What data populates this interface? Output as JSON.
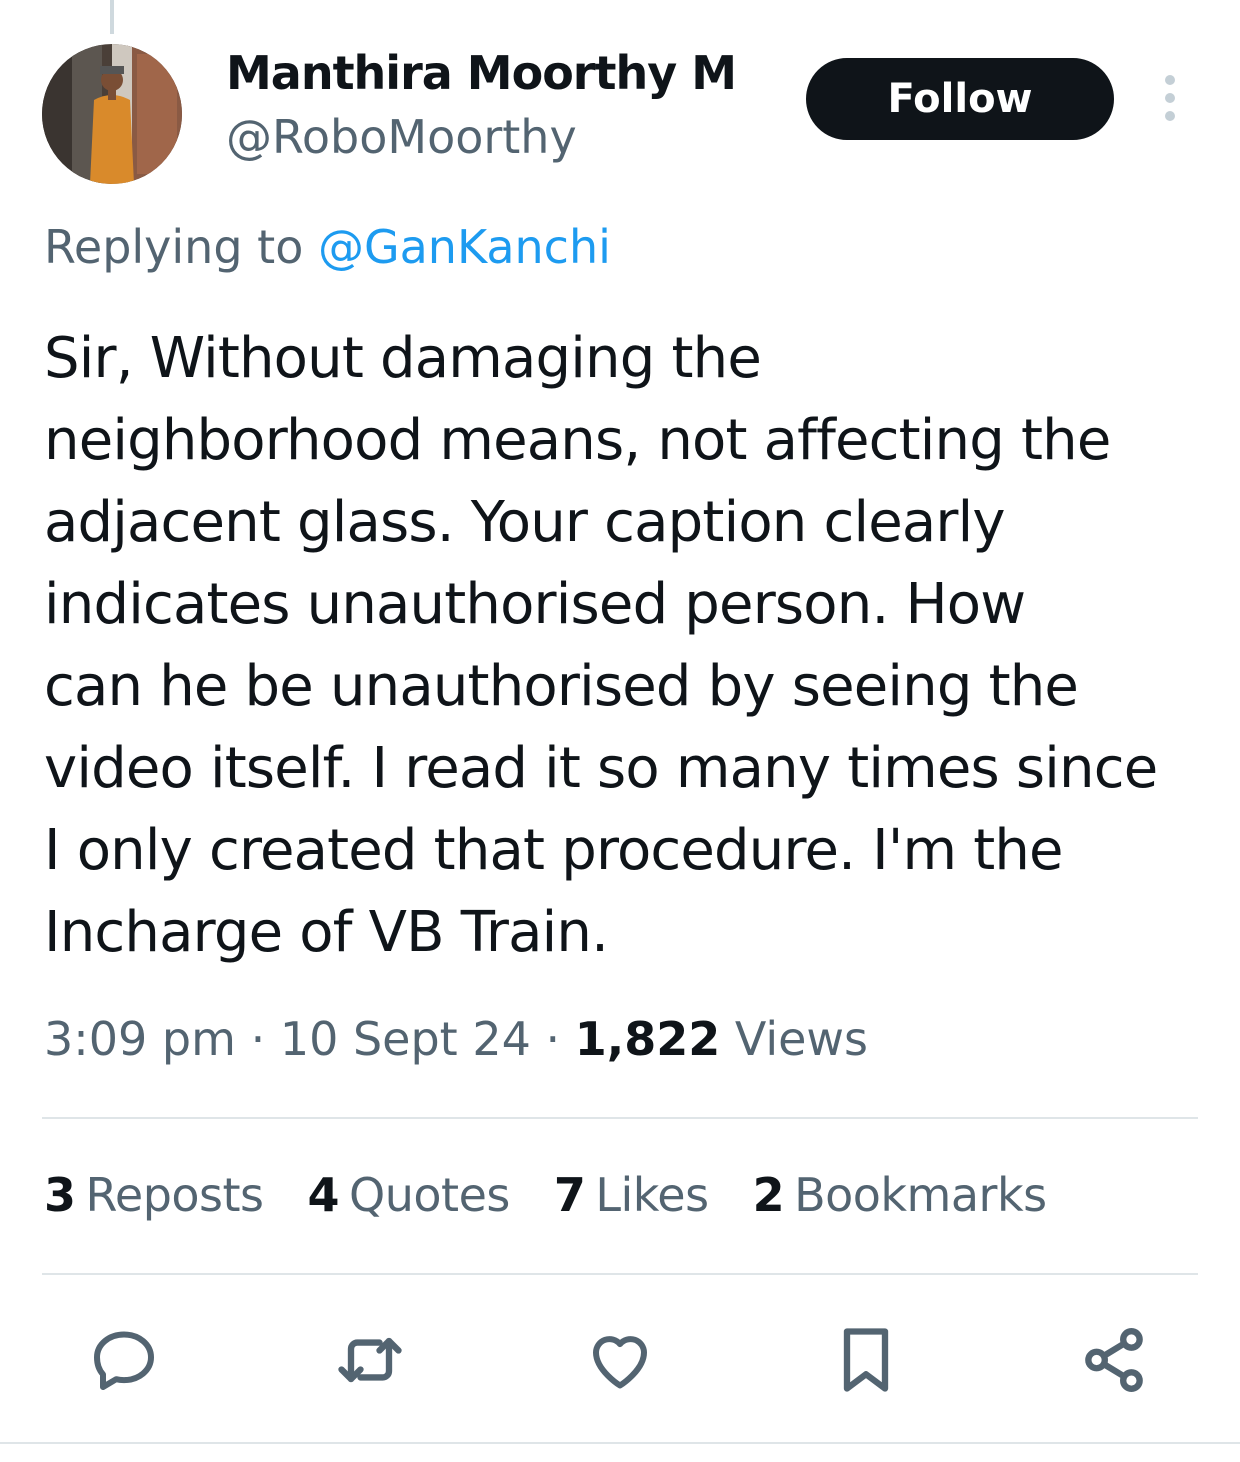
{
  "author": {
    "display_name": "Manthira Moorthy M",
    "handle": "@RoboMoorthy",
    "avatar_icon": "avatar-photo"
  },
  "follow_button": {
    "label": "Follow"
  },
  "more_icon": "more-options-icon",
  "reply": {
    "prefix": "Replying to",
    "target": "@GanKanchi"
  },
  "tweet": {
    "text": "Sir, Without damaging the\nneighborhood means, not affecting the\nadjacent glass. Your caption clearly\nindicates unauthorised person. How\ncan he be unauthorised by seeing the\nvideo itself. I read it so many times since\nI only created that procedure. I'm the\nIncharge of VB Train."
  },
  "meta": {
    "time": "3:09 pm",
    "separator": "·",
    "date": "10 Sept 24",
    "views_count": "1,822",
    "views_label": "Views"
  },
  "stats": [
    {
      "count": "3",
      "label": "Reposts"
    },
    {
      "count": "4",
      "label": "Quotes"
    },
    {
      "count": "7",
      "label": "Likes"
    },
    {
      "count": "2",
      "label": "Bookmarks"
    }
  ],
  "actions": [
    {
      "icon": "reply-icon"
    },
    {
      "icon": "repost-icon"
    },
    {
      "icon": "like-icon"
    },
    {
      "icon": "bookmark-icon"
    },
    {
      "icon": "share-icon"
    }
  ],
  "colors": {
    "primary_text": "#0f1419",
    "secondary_text": "#536471",
    "link": "#1d9bf0",
    "divider": "#dfe5e8",
    "button_bg": "#0f1419"
  }
}
